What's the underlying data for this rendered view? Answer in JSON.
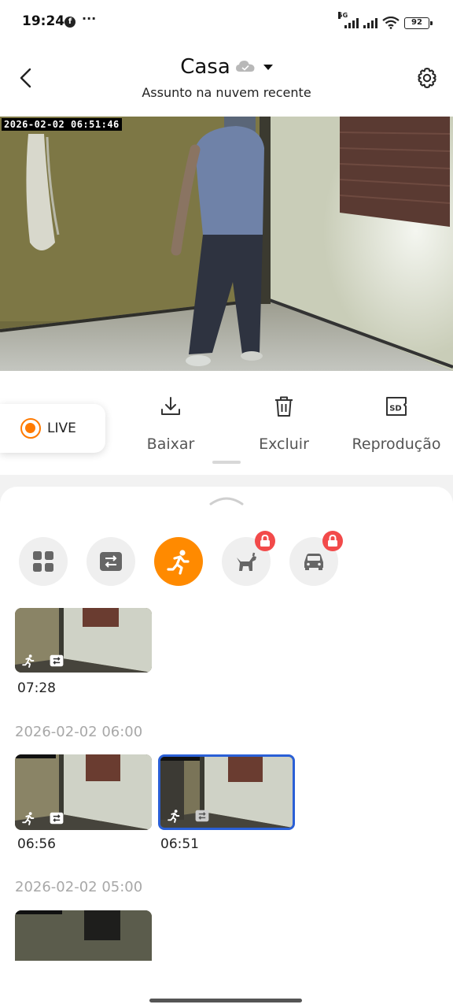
{
  "status_bar": {
    "time": "19:24",
    "dots": "···",
    "network": "5G",
    "battery": "92"
  },
  "header": {
    "title": "Casa",
    "subtitle": "Assunto na nuvem recente"
  },
  "video": {
    "timestamp": "2026-02-02 06:51:46"
  },
  "actions": {
    "live_label": "LIVE",
    "download_label": "Baixar",
    "delete_label": "Excluir",
    "playback_label": "Reprodução",
    "playback_icon_text": "SD"
  },
  "filters": [
    {
      "name": "all-events",
      "icon": "grid-icon",
      "active": false,
      "locked": false
    },
    {
      "name": "motion-detect",
      "icon": "frame-switch-icon",
      "active": false,
      "locked": false
    },
    {
      "name": "person",
      "icon": "running-person-icon",
      "active": true,
      "locked": false
    },
    {
      "name": "pet",
      "icon": "dog-icon",
      "active": false,
      "locked": true
    },
    {
      "name": "vehicle",
      "icon": "car-icon",
      "active": false,
      "locked": true
    }
  ],
  "clips": {
    "top": [
      {
        "time": "07:28"
      }
    ],
    "groups": [
      {
        "label": "2026-02-02 06:00",
        "clips": [
          {
            "time": "06:56"
          },
          {
            "time": "06:51",
            "selected": true
          }
        ]
      },
      {
        "label": "2026-02-02 05:00",
        "clips": [
          {
            "time": ""
          }
        ]
      }
    ]
  },
  "colors": {
    "accent": "#ff8a00",
    "live": "#ff7a00",
    "selected_border": "#2a5fd6",
    "lock_badge": "#f24a4a"
  }
}
